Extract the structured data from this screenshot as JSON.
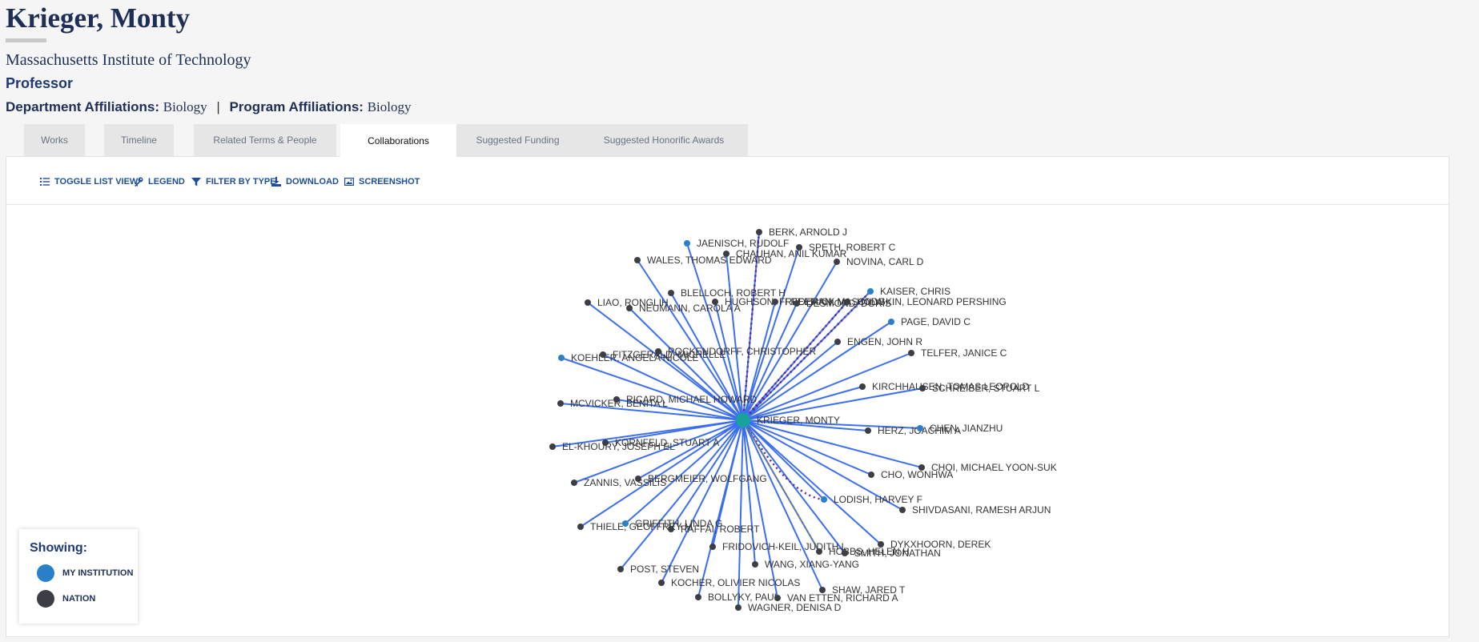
{
  "profile": {
    "name": "Krieger, Monty",
    "institution": "Massachusetts Institute of Technology",
    "title": "Professor",
    "department_label": "Department Affiliations:",
    "department_value": "Biology",
    "program_label": "Program Affiliations:",
    "program_value": "Biology"
  },
  "tabs": [
    {
      "label": "Works"
    },
    {
      "label": "Timeline"
    },
    {
      "label": "Related Terms & People"
    },
    {
      "label": "Collaborations",
      "active": true
    },
    {
      "label": "Suggested Funding"
    },
    {
      "label": "Suggested Honorific Awards"
    }
  ],
  "toolbar": {
    "toggle_list": "TOGGLE LIST VIEW",
    "legend": "LEGEND",
    "filter": "FILTER BY TYPE",
    "download": "DOWNLOAD",
    "screenshot": "SCREENSHOT"
  },
  "legend": {
    "title": "Showing:",
    "my_institution": "MY INSTITUTION",
    "nation": "NATION"
  },
  "colors": {
    "edge": "#3b6ef0",
    "my_institution": "#2a7fc9",
    "nation": "#3b3f45",
    "center": "#17a39a",
    "dotted_purple": "#6a1b9a",
    "dotted_olive": "#9a8a1b"
  },
  "network": {
    "center": {
      "name": "KRIEGER, MONTY"
    },
    "nodes": [
      {
        "name": "BERK, ARNOLD J",
        "type": "nation"
      },
      {
        "name": "JAENISCH, RUDOLF",
        "type": "institution"
      },
      {
        "name": "SPETH, ROBERT C",
        "type": "nation"
      },
      {
        "name": "CHAUHAN, ANIL KUMAR",
        "type": "nation"
      },
      {
        "name": "WALES, THOMAS EDWARD",
        "type": "nation"
      },
      {
        "name": "NOVINA, CARL D",
        "type": "nation"
      },
      {
        "name": "KAISER, CHRIS",
        "type": "institution"
      },
      {
        "name": "BLELLOCH, ROBERT H",
        "type": "nation"
      },
      {
        "name": "HUGHSON, FREDERICK M",
        "type": "nation"
      },
      {
        "name": "FREEMAN, MASON W",
        "type": "nation"
      },
      {
        "name": "DESMOND, DORIS",
        "type": "nation"
      },
      {
        "name": "HODGKIN, LEONARD PERSHING",
        "type": "nation"
      },
      {
        "name": "LIAO, RONGLIH",
        "type": "nation"
      },
      {
        "name": "NEUMANN, CAROLA A",
        "type": "nation"
      },
      {
        "name": "PAGE, DAVID C",
        "type": "institution"
      },
      {
        "name": "ENGEN, JOHN R",
        "type": "nation"
      },
      {
        "name": "TELFER, JANICE C",
        "type": "nation"
      },
      {
        "name": "KOEHLER, ANGELA NICOLE",
        "type": "institution"
      },
      {
        "name": "FITZGERALD, MICHELLE",
        "type": "nation"
      },
      {
        "name": "ROCKENDORFF, CHRISTOPHER",
        "type": "nation"
      },
      {
        "name": "KIRCHHAUSEN, TOMAS LEOPOLD",
        "type": "nation"
      },
      {
        "name": "SCHREIBER, STUART L",
        "type": "nation"
      },
      {
        "name": "MCVICKER, BENITA L",
        "type": "nation"
      },
      {
        "name": "RICARD, MICHAEL HOWARD",
        "type": "nation"
      },
      {
        "name": "HERZ, JOACHIM A",
        "type": "nation"
      },
      {
        "name": "CHEN, JIANZHU",
        "type": "institution"
      },
      {
        "name": "EL-KHOURY, JOSEPH EL",
        "type": "nation"
      },
      {
        "name": "KORNFELD, STUART A",
        "type": "nation"
      },
      {
        "name": "CHOI, MICHAEL YOON-SUK",
        "type": "nation"
      },
      {
        "name": "CHO, WONHWA",
        "type": "nation"
      },
      {
        "name": "ZANNIS, VASSILIS",
        "type": "nation"
      },
      {
        "name": "BERGMEIER, WOLFGANG",
        "type": "nation"
      },
      {
        "name": "LODISH, HARVEY F",
        "type": "institution"
      },
      {
        "name": "SHIVDASANI, RAMESH ARJUN",
        "type": "nation"
      },
      {
        "name": "THIELE, GEOFFREY M",
        "type": "nation"
      },
      {
        "name": "GRIFFITH, LINDA G",
        "type": "institution"
      },
      {
        "name": "RAFFAI, ROBERT",
        "type": "nation"
      },
      {
        "name": "FRIDOVICH-KEIL, JUDITH L",
        "type": "nation"
      },
      {
        "name": "HOBBS, HELEN H",
        "type": "nation"
      },
      {
        "name": "SMITH, JONATHAN",
        "type": "nation"
      },
      {
        "name": "DYKXHOORN, DEREK",
        "type": "nation"
      },
      {
        "name": "POST, STEVEN",
        "type": "nation"
      },
      {
        "name": "WANG, XIANG-YANG",
        "type": "nation"
      },
      {
        "name": "KOCHER, OLIVIER NICOLAS",
        "type": "nation"
      },
      {
        "name": "SHAW, JARED T",
        "type": "nation"
      },
      {
        "name": "BOLLYKY, PAUL",
        "type": "nation"
      },
      {
        "name": "VAN ETTEN, RICHARD A",
        "type": "nation"
      },
      {
        "name": "WAGNER, DENISA D",
        "type": "nation"
      }
    ]
  }
}
